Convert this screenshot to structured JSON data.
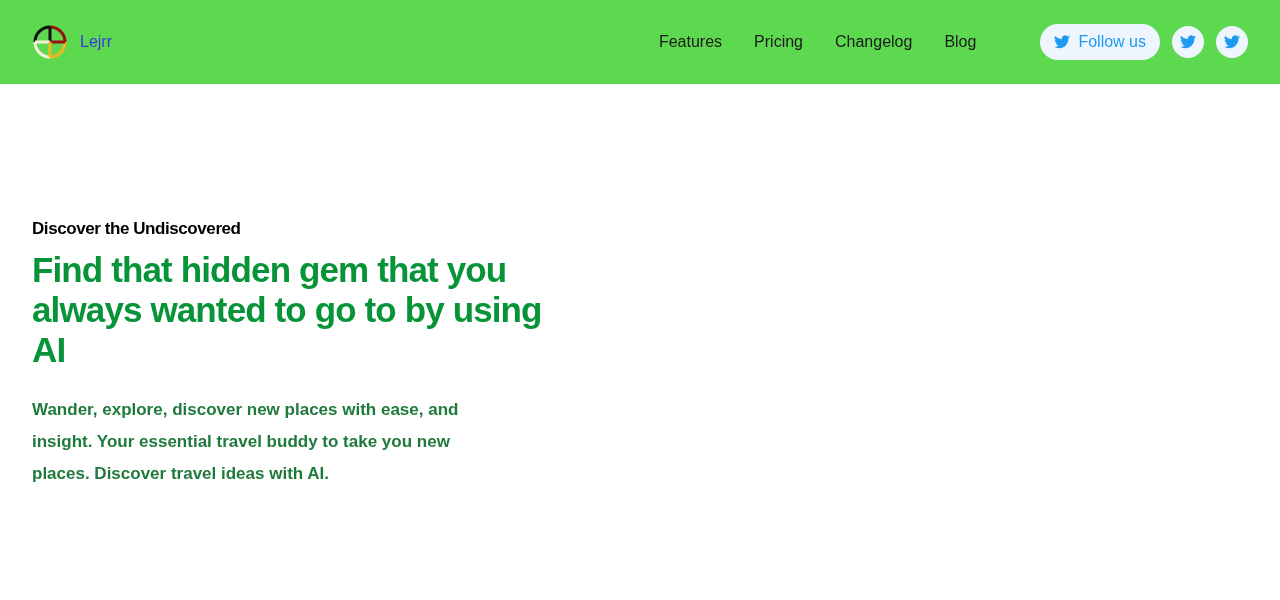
{
  "header": {
    "brand": "Lejrr",
    "nav": [
      "Features",
      "Pricing",
      "Changelog",
      "Blog"
    ],
    "follow_button": "Follow us"
  },
  "hero": {
    "eyebrow": "Discover the Undiscovered",
    "title": "Find that hidden gem that you always wanted to go to by using AI",
    "body": "Wander, explore, discover new places with ease, and insight. Your essential travel buddy to take you new places. Discover travel ideas with AI."
  }
}
